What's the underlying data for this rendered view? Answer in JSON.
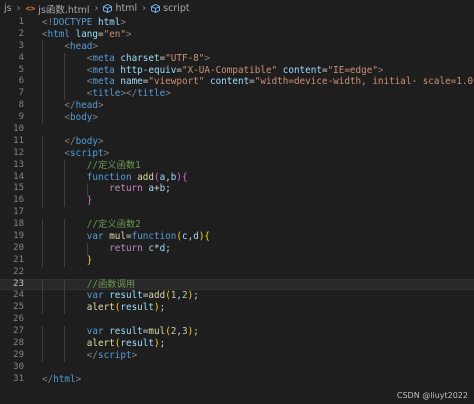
{
  "breadcrumb": {
    "folder": "js",
    "file": "js函数.html",
    "tag_html": "html",
    "tag_script": "script"
  },
  "colors": {
    "background": "#1e1e1e",
    "line_number": "#858585",
    "tag_bracket": "#808080",
    "tag_name": "#569cd6",
    "attribute": "#9cdcfe",
    "string": "#ce9178",
    "comment": "#6a9955",
    "keyword": "#569cd6",
    "control_keyword": "#c586c0",
    "function_name": "#dcdcaa",
    "variable": "#9cdcfe",
    "number": "#b5cea8",
    "bracket_1": "#ffd700",
    "bracket_2": "#da70d6",
    "plain": "#d4d4d4"
  },
  "active_line": 23,
  "lines": [
    {
      "n": "1",
      "tokens": [
        [
          "<!",
          "br"
        ],
        [
          "DOCTYPE",
          "tag"
        ],
        [
          " ",
          "p"
        ],
        [
          "html",
          "attr"
        ],
        [
          ">",
          "br"
        ]
      ]
    },
    {
      "n": "2",
      "tokens": [
        [
          "<",
          "br"
        ],
        [
          "html",
          "tag"
        ],
        [
          " ",
          "p"
        ],
        [
          "lang",
          "attr"
        ],
        [
          "=",
          "p"
        ],
        [
          "\"en\"",
          "str"
        ],
        [
          ">",
          "br"
        ]
      ]
    },
    {
      "n": "3",
      "tokens": [
        [
          "    ",
          "p"
        ],
        [
          "<",
          "br"
        ],
        [
          "head",
          "tag"
        ],
        [
          ">",
          "br"
        ]
      ]
    },
    {
      "n": "4",
      "tokens": [
        [
          "        ",
          "p"
        ],
        [
          "<",
          "br"
        ],
        [
          "meta",
          "tag"
        ],
        [
          " ",
          "p"
        ],
        [
          "charset",
          "attr"
        ],
        [
          "=",
          "p"
        ],
        [
          "\"UTF-8\"",
          "str"
        ],
        [
          ">",
          "br"
        ]
      ]
    },
    {
      "n": "5",
      "tokens": [
        [
          "        ",
          "p"
        ],
        [
          "<",
          "br"
        ],
        [
          "meta",
          "tag"
        ],
        [
          " ",
          "p"
        ],
        [
          "http-equiv",
          "attr"
        ],
        [
          "=",
          "p"
        ],
        [
          "\"X-UA-Compatible\"",
          "str"
        ],
        [
          " ",
          "p"
        ],
        [
          "content",
          "attr"
        ],
        [
          "=",
          "p"
        ],
        [
          "\"IE=edge\"",
          "str"
        ],
        [
          ">",
          "br"
        ]
      ]
    },
    {
      "n": "6",
      "tokens": [
        [
          "        ",
          "p"
        ],
        [
          "<",
          "br"
        ],
        [
          "meta",
          "tag"
        ],
        [
          " ",
          "p"
        ],
        [
          "name",
          "attr"
        ],
        [
          "=",
          "p"
        ],
        [
          "\"viewport\"",
          "str"
        ],
        [
          " ",
          "p"
        ],
        [
          "content",
          "attr"
        ],
        [
          "=",
          "p"
        ],
        [
          "\"width=device-width, initial- scale=1.0\"",
          "str"
        ],
        [
          ">",
          "br"
        ]
      ]
    },
    {
      "n": "7",
      "tokens": [
        [
          "        ",
          "p"
        ],
        [
          "<",
          "br"
        ],
        [
          "title",
          "tag"
        ],
        [
          "></",
          "br"
        ],
        [
          "title",
          "tag"
        ],
        [
          ">",
          "br"
        ]
      ]
    },
    {
      "n": "8",
      "tokens": [
        [
          "    ",
          "p"
        ],
        [
          "</",
          "br"
        ],
        [
          "head",
          "tag"
        ],
        [
          ">",
          "br"
        ]
      ]
    },
    {
      "n": "9",
      "tokens": [
        [
          "    ",
          "p"
        ],
        [
          "<",
          "br"
        ],
        [
          "body",
          "tag"
        ],
        [
          ">",
          "br"
        ]
      ]
    },
    {
      "n": "10",
      "tokens": []
    },
    {
      "n": "11",
      "tokens": [
        [
          "    ",
          "p"
        ],
        [
          "</",
          "br"
        ],
        [
          "body",
          "tag"
        ],
        [
          ">",
          "br"
        ]
      ]
    },
    {
      "n": "12",
      "tokens": [
        [
          "    ",
          "p"
        ],
        [
          "<",
          "br"
        ],
        [
          "script",
          "tag"
        ],
        [
          ">",
          "br"
        ]
      ]
    },
    {
      "n": "13",
      "tokens": [
        [
          "        ",
          "p"
        ],
        [
          "//定义函数1",
          "cm"
        ]
      ]
    },
    {
      "n": "14",
      "tokens": [
        [
          "        ",
          "p"
        ],
        [
          "function",
          "kw"
        ],
        [
          " ",
          "p"
        ],
        [
          "add",
          "fn"
        ],
        [
          "(",
          "b2"
        ],
        [
          "a",
          "var"
        ],
        [
          ",",
          "p"
        ],
        [
          "b",
          "var"
        ],
        [
          ")",
          "b2"
        ],
        [
          "{",
          "b2"
        ]
      ]
    },
    {
      "n": "15",
      "tokens": [
        [
          "            ",
          "p"
        ],
        [
          "return",
          "ctl"
        ],
        [
          " ",
          "p"
        ],
        [
          "a",
          "var"
        ],
        [
          "+",
          "p"
        ],
        [
          "b",
          "var"
        ],
        [
          ";",
          "p"
        ]
      ]
    },
    {
      "n": "16",
      "tokens": [
        [
          "        ",
          "p"
        ],
        [
          "}",
          "b2"
        ]
      ]
    },
    {
      "n": "17",
      "tokens": []
    },
    {
      "n": "18",
      "tokens": [
        [
          "        ",
          "p"
        ],
        [
          "//定义函数2",
          "cm"
        ]
      ]
    },
    {
      "n": "19",
      "tokens": [
        [
          "        ",
          "p"
        ],
        [
          "var",
          "kw"
        ],
        [
          " ",
          "p"
        ],
        [
          "mul",
          "fn"
        ],
        [
          "=",
          "p"
        ],
        [
          "function",
          "kw"
        ],
        [
          "(",
          "b1"
        ],
        [
          "c",
          "var"
        ],
        [
          ",",
          "p"
        ],
        [
          "d",
          "var"
        ],
        [
          ")",
          "b1"
        ],
        [
          "{",
          "b1"
        ]
      ]
    },
    {
      "n": "20",
      "tokens": [
        [
          "            ",
          "p"
        ],
        [
          "return",
          "ctl"
        ],
        [
          " ",
          "p"
        ],
        [
          "c",
          "var"
        ],
        [
          "*",
          "p"
        ],
        [
          "d",
          "var"
        ],
        [
          ";",
          "p"
        ]
      ]
    },
    {
      "n": "21",
      "tokens": [
        [
          "        ",
          "p"
        ],
        [
          "}",
          "b1"
        ]
      ]
    },
    {
      "n": "22",
      "tokens": []
    },
    {
      "n": "23",
      "tokens": [
        [
          "        ",
          "p"
        ],
        [
          "//函数调用",
          "cm"
        ]
      ]
    },
    {
      "n": "24",
      "tokens": [
        [
          "        ",
          "p"
        ],
        [
          "var",
          "kw"
        ],
        [
          " ",
          "p"
        ],
        [
          "result",
          "var"
        ],
        [
          "=",
          "p"
        ],
        [
          "add",
          "fn"
        ],
        [
          "(",
          "b1"
        ],
        [
          "1",
          "num"
        ],
        [
          ",",
          "p"
        ],
        [
          "2",
          "num"
        ],
        [
          ")",
          "b1"
        ],
        [
          ";",
          "p"
        ]
      ]
    },
    {
      "n": "25",
      "tokens": [
        [
          "        ",
          "p"
        ],
        [
          "alert",
          "fn"
        ],
        [
          "(",
          "b1"
        ],
        [
          "result",
          "var"
        ],
        [
          ")",
          "b1"
        ],
        [
          ";",
          "p"
        ]
      ]
    },
    {
      "n": "26",
      "tokens": []
    },
    {
      "n": "27",
      "tokens": [
        [
          "        ",
          "p"
        ],
        [
          "var",
          "kw"
        ],
        [
          " ",
          "p"
        ],
        [
          "result",
          "var"
        ],
        [
          "=",
          "p"
        ],
        [
          "mul",
          "fn"
        ],
        [
          "(",
          "b1"
        ],
        [
          "2",
          "num"
        ],
        [
          ",",
          "p"
        ],
        [
          "3",
          "num"
        ],
        [
          ")",
          "b1"
        ],
        [
          ";",
          "p"
        ]
      ]
    },
    {
      "n": "28",
      "tokens": [
        [
          "        ",
          "p"
        ],
        [
          "alert",
          "fn"
        ],
        [
          "(",
          "b1"
        ],
        [
          "result",
          "var"
        ],
        [
          ")",
          "b1"
        ],
        [
          ";",
          "p"
        ]
      ]
    },
    {
      "n": "29",
      "tokens": [
        [
          "        ",
          "p"
        ],
        [
          "</",
          "br"
        ],
        [
          "script",
          "tag"
        ],
        [
          ">",
          "br"
        ]
      ]
    },
    {
      "n": "30",
      "tokens": []
    },
    {
      "n": "31",
      "tokens": [
        [
          "</",
          "br"
        ],
        [
          "html",
          "tag"
        ],
        [
          ">",
          "br"
        ]
      ]
    }
  ],
  "watermark": "CSDN @liuyt2022"
}
